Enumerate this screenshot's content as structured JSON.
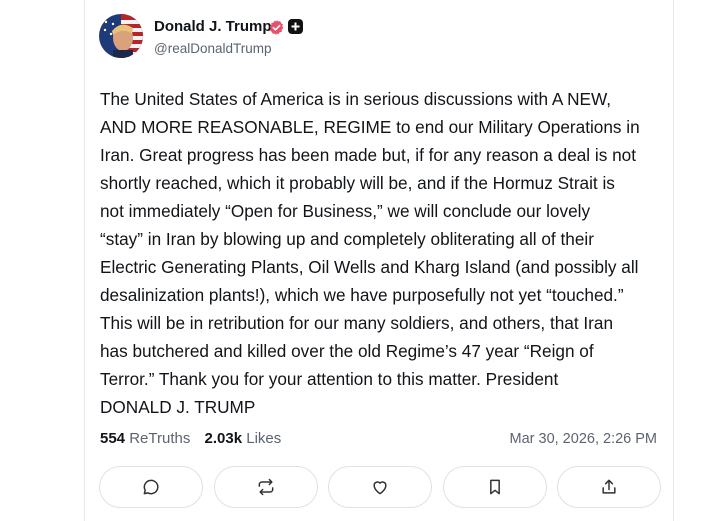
{
  "post": {
    "author_name": "Donald J. Trump",
    "handle": "@realDonaldTrump",
    "verified_icon": "verified-badge-icon",
    "plus_icon": "plus-badge-icon",
    "body": "The United States of America is in serious discussions with A NEW,\nAND MORE REASONABLE, REGIME to end our Military Operations in\nIran. Great progress has been made but, if for any reason a deal is not\nshortly reached, which it probably will be, and if the Hormuz Strait is\nnot immediately “Open for Business,” we will conclude our lovely\n“stay” in Iran by blowing up and completely obliterating all of their\nElectric Generating Plants, Oil Wells and Kharg Island (and possibly all\ndesalinization plants!), which we have purposefully not yet “touched.”\nThis will be in retribution for our many soldiers, and others, that Iran\nhas butchered and killed over the old Regime’s 47 year “Reign of\nTerror.” Thank you for your attention to this matter. President\nDONALD J. TRUMP",
    "retruths_count": "554",
    "retruths_label": "ReTruths",
    "likes_count": "2.03k",
    "likes_label": "Likes",
    "timestamp": "Mar 30, 2026, 2:26 PM"
  },
  "actions": [
    {
      "name": "reply",
      "icon": "reply-icon"
    },
    {
      "name": "retruth",
      "icon": "retruth-icon"
    },
    {
      "name": "like",
      "icon": "heart-icon"
    },
    {
      "name": "bookmark",
      "icon": "bookmark-icon"
    },
    {
      "name": "share",
      "icon": "share-icon"
    }
  ],
  "colors": {
    "verified": "#e8506b",
    "muted_text": "#5b6470",
    "border": "#dfe2e6"
  }
}
